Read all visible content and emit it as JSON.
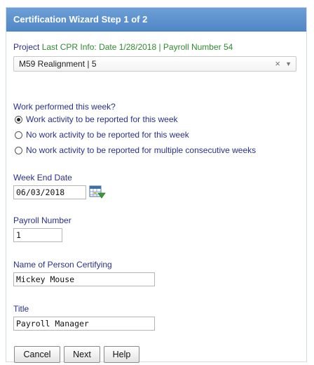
{
  "header": {
    "title": "Certification Wizard Step 1 of 2"
  },
  "project": {
    "label": "Project",
    "info": "Last CPR Info: Date 1/28/2018 | Payroll Number 54",
    "selected_value": "M59 Realignment | 5",
    "clear_glyph": "×",
    "dropdown_glyph": "▼"
  },
  "work_performed": {
    "question": "Work performed this week?",
    "options": [
      {
        "label": "Work activity to be reported for this week",
        "checked": true
      },
      {
        "label": "No work activity to be reported for this week",
        "checked": false
      },
      {
        "label": "No work activity to be reported for multiple consecutive weeks",
        "checked": false
      }
    ]
  },
  "week_end_date": {
    "label": "Week End Date",
    "value": "06/03/2018",
    "icon": "calendar-dropdown-icon"
  },
  "payroll_number": {
    "label": "Payroll Number",
    "value": "1"
  },
  "certifier_name": {
    "label": "Name of Person Certifying",
    "value": "Mickey Mouse"
  },
  "title_field": {
    "label": "Title",
    "value": "Payroll Manager"
  },
  "buttons": {
    "cancel": "Cancel",
    "next": "Next",
    "help": "Help"
  },
  "colors": {
    "header_bg": "#5a8fcd",
    "label_text": "#2a2f8c",
    "info_text": "#2e8a2e"
  }
}
